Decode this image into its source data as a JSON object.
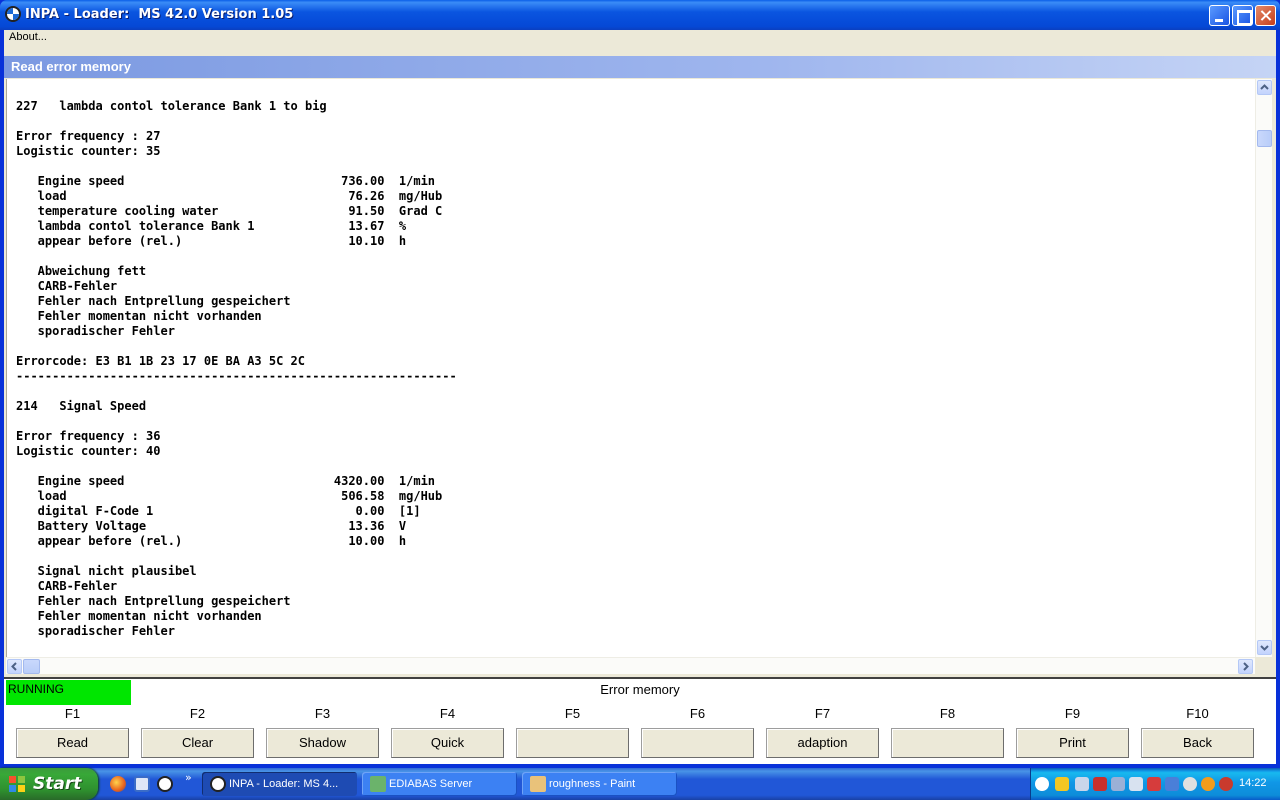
{
  "window": {
    "title": "INPA - Loader:  MS 42.0 Version 1.05"
  },
  "menu": {
    "about": "About..."
  },
  "panel": {
    "header": "Read error memory"
  },
  "output_lines": [
    "227   lambda contol tolerance Bank 1 to big",
    "",
    "Error frequency : 27",
    "Logistic counter: 35",
    "",
    "   Engine speed                              736.00  1/min",
    "   load                                       76.26  mg/Hub",
    "   temperature cooling water                  91.50  Grad C",
    "   lambda contol tolerance Bank 1             13.67  %",
    "   appear before (rel.)                       10.10  h",
    "",
    "   Abweichung fett",
    "   CARB-Fehler",
    "   Fehler nach Entprellung gespeichert",
    "   Fehler momentan nicht vorhanden",
    "   sporadischer Fehler",
    "",
    "Errorcode: E3 B1 1B 23 17 0E BA A3 5C 2C",
    "-------------------------------------------------------------",
    "",
    "214   Signal Speed",
    "",
    "Error frequency : 36",
    "Logistic counter: 40",
    "",
    "   Engine speed                             4320.00  1/min",
    "   load                                      506.58  mg/Hub",
    "   digital F-Code 1                            0.00  [1]",
    "   Battery Voltage                            13.36  V",
    "   appear before (rel.)                       10.00  h",
    "",
    "   Signal nicht plausibel",
    "   CARB-Fehler",
    "   Fehler nach Entprellung gespeichert",
    "   Fehler momentan nicht vorhanden",
    "   sporadischer Fehler"
  ],
  "status": {
    "state": "RUNNING",
    "state_color": "#00e600",
    "title": "Error memory"
  },
  "fkeys": [
    {
      "key": "F1",
      "label": "Read"
    },
    {
      "key": "F2",
      "label": "Clear"
    },
    {
      "key": "F3",
      "label": "Shadow"
    },
    {
      "key": "F4",
      "label": "Quick"
    },
    {
      "key": "F5",
      "label": ""
    },
    {
      "key": "F6",
      "label": ""
    },
    {
      "key": "F7",
      "label": "adaption"
    },
    {
      "key": "F8",
      "label": ""
    },
    {
      "key": "F9",
      "label": "Print"
    },
    {
      "key": "F10",
      "label": "Back"
    }
  ],
  "taskbar": {
    "start": "Start",
    "quicklaunch_more": "»",
    "tasks": [
      {
        "label": "INPA - Loader:  MS 4...",
        "icon": "bmw-icon"
      },
      {
        "label": "EDIABAS Server",
        "icon": "server-icon"
      },
      {
        "label": "roughness - Paint",
        "icon": "paint-icon"
      }
    ],
    "clock": "14:22"
  }
}
